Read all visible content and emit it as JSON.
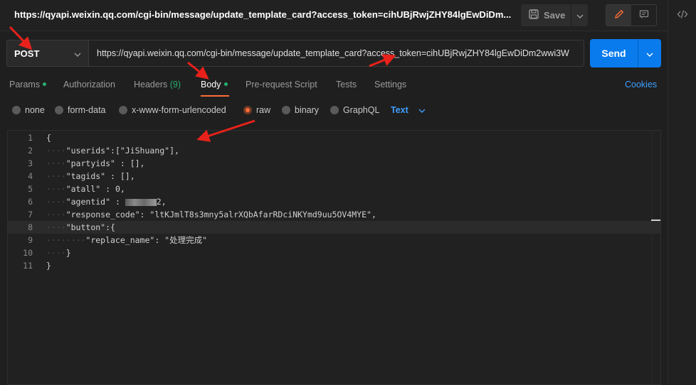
{
  "request": {
    "title": "https://qyapi.weixin.qq.com/cgi-bin/message/update_template_card?access_token=cihUBjRwjZHY84lgEwDiDm...",
    "method": "POST",
    "url": "https://qyapi.weixin.qq.com/cgi-bin/message/update_template_card?access_token=cihUBjRwjZHY84lgEwDiDm2wwi3W"
  },
  "toolbar": {
    "save_label": "Save",
    "send_label": "Send"
  },
  "tabs": [
    {
      "label": "Params",
      "dot": true
    },
    {
      "label": "Authorization"
    },
    {
      "label": "Headers",
      "count": "(9)"
    },
    {
      "label": "Body",
      "dot": true,
      "active": true
    },
    {
      "label": "Pre-request Script"
    },
    {
      "label": "Tests"
    },
    {
      "label": "Settings"
    }
  ],
  "cookies_label": "Cookies",
  "body_types": [
    {
      "label": "none"
    },
    {
      "label": "form-data"
    },
    {
      "label": "x-www-form-urlencoded"
    },
    {
      "label": "raw",
      "selected": true
    },
    {
      "label": "binary"
    },
    {
      "label": "GraphQL"
    }
  ],
  "raw_format": "Text",
  "editor": {
    "lines": [
      {
        "num": "1",
        "indent": "",
        "text": "{"
      },
      {
        "num": "2",
        "indent": "····",
        "text": "\"userids\":[\"JiShuang\"],"
      },
      {
        "num": "3",
        "indent": "····",
        "text": "\"partyids\" : [],"
      },
      {
        "num": "4",
        "indent": "····",
        "text": "\"tagids\" : [],"
      },
      {
        "num": "5",
        "indent": "····",
        "text": "\"atall\" : 0,"
      },
      {
        "num": "6",
        "indent": "····",
        "text_before": "\"agentid\" : ",
        "text_after": "2,"
      },
      {
        "num": "7",
        "indent": "····",
        "text": "\"response_code\": \"ltKJmlT8s3mny5alrXQbAfarRDciNKYmd9uu5OV4MYE\","
      },
      {
        "num": "8",
        "indent": "····",
        "text": "\"button\":{"
      },
      {
        "num": "9",
        "indent": "········",
        "text": "\"replace_name\": \"处理完成\""
      },
      {
        "num": "10",
        "indent": "····",
        "text": "}"
      },
      {
        "num": "11",
        "indent": "",
        "text": "}"
      }
    ]
  },
  "colors": {
    "accent_orange": "#ff6c37",
    "send_blue": "#097bed",
    "link_blue": "#3e9fff",
    "status_green": "#29b06f",
    "annotation_red": "#e8221b"
  }
}
